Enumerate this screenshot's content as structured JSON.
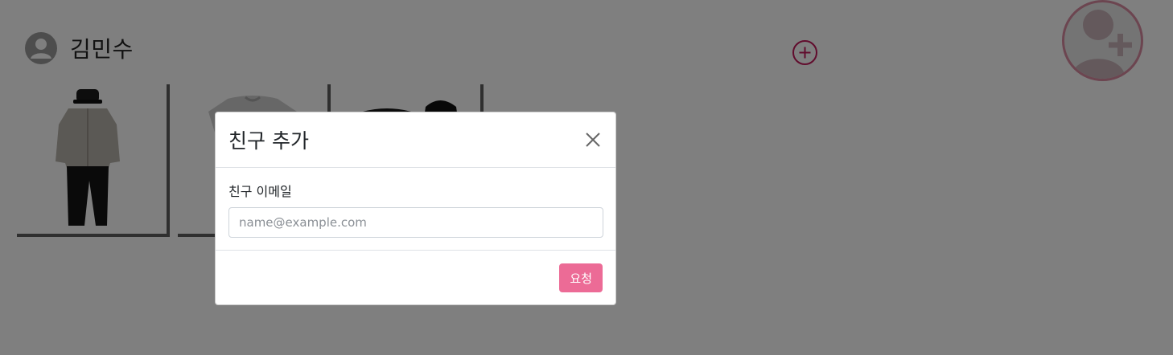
{
  "profile": {
    "name": "김민수",
    "avatar_icon": "person-icon"
  },
  "actions": {
    "add_outfit_icon": "plus-circle-icon",
    "add_friend_icon": "person-plus-icon"
  },
  "closet": {
    "cards": [
      {
        "icon": "outfit-jacket-pants"
      },
      {
        "icon": "outfit-sweatshirt"
      },
      {
        "icon": "outfit-black-set"
      }
    ]
  },
  "modal": {
    "title": "친구 추가",
    "close_icon": "close-icon",
    "email_label": "친구 이메일",
    "email_placeholder": "name@example.com",
    "email_value": "",
    "submit_label": "요청"
  },
  "colors": {
    "accent_pink": "#ec6b96",
    "accent_dark_pink": "#c2185b",
    "backdrop": "rgba(0,0,0,0.5)"
  }
}
